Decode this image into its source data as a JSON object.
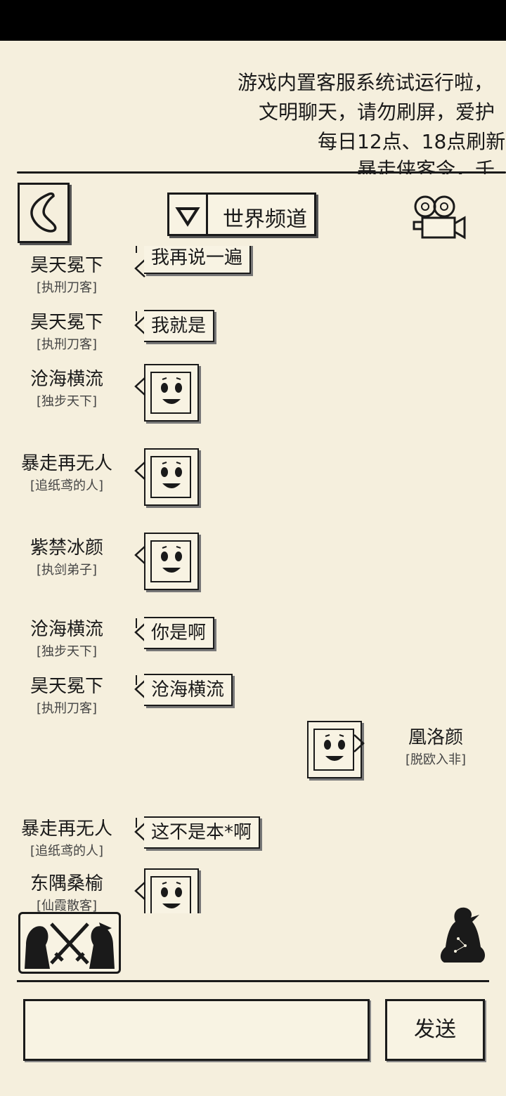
{
  "notice": {
    "line1": "游戏内置客服系统试运行啦，",
    "line2": "文明聊天，请勿刷屏，爱护",
    "line3": "每日12点、18点刷新",
    "line4": "暴走侠客令，千"
  },
  "header": {
    "channel_label": "世界频道"
  },
  "messages": [
    {
      "name": "昊天冕下",
      "title": "[执刑刀客]",
      "text": "我再说一遍"
    },
    {
      "name": "昊天冕下",
      "title": "[执刑刀客]",
      "text": "我就是"
    },
    {
      "name": "沧海横流",
      "title": "[独步天下]",
      "sticker": "smiley-face-sticker"
    },
    {
      "name": "暴走再无人",
      "title": "[追纸鸢的人]",
      "sticker": "smiley-face-sticker"
    },
    {
      "name": "紫禁冰颜",
      "title": "[执剑弟子]",
      "sticker": "smiley-face-sticker"
    },
    {
      "name": "沧海横流",
      "title": "[独步天下]",
      "text": "你是啊"
    },
    {
      "name": "昊天冕下",
      "title": "[执刑刀客]",
      "text": "沧海横流"
    },
    {
      "name": "凰洛颜",
      "title": "[脱欧入非]",
      "sticker": "smiley-face-sticker",
      "self": true
    },
    {
      "name": "暴走再无人",
      "title": "[追纸鸢的人]",
      "text": "这不是本*啊"
    },
    {
      "name": "东隅桑榆",
      "title": "[仙霞散客]",
      "sticker": "smiley-face-sticker"
    }
  ],
  "input": {
    "value": ""
  },
  "send_label": "发送",
  "colors": {
    "background": "#f5efdd",
    "ink": "#1a1a1a"
  }
}
